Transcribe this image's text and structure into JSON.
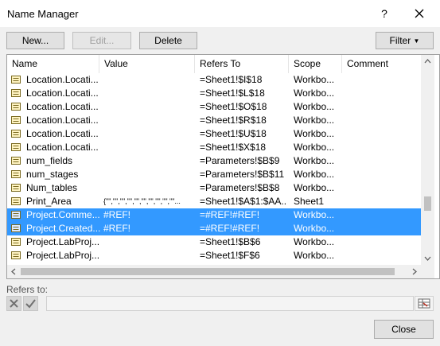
{
  "window": {
    "title": "Name Manager",
    "help_label": "?"
  },
  "toolbar": {
    "new_label": "New...",
    "edit_label": "Edit...",
    "delete_label": "Delete",
    "filter_label": "Filter"
  },
  "table": {
    "columns": [
      "Name",
      "Value",
      "Refers To",
      "Scope",
      "Comment"
    ],
    "rows": [
      {
        "name": "Location.Locati...",
        "value": "",
        "refers_to": "=Sheet1!$I$18",
        "scope": "Workbo...",
        "comment": "",
        "selected": false
      },
      {
        "name": "Location.Locati...",
        "value": "",
        "refers_to": "=Sheet1!$L$18",
        "scope": "Workbo...",
        "comment": "",
        "selected": false
      },
      {
        "name": "Location.Locati...",
        "value": "",
        "refers_to": "=Sheet1!$O$18",
        "scope": "Workbo...",
        "comment": "",
        "selected": false
      },
      {
        "name": "Location.Locati...",
        "value": "",
        "refers_to": "=Sheet1!$R$18",
        "scope": "Workbo...",
        "comment": "",
        "selected": false
      },
      {
        "name": "Location.Locati...",
        "value": "",
        "refers_to": "=Sheet1!$U$18",
        "scope": "Workbo...",
        "comment": "",
        "selected": false
      },
      {
        "name": "Location.Locati...",
        "value": "",
        "refers_to": "=Sheet1!$X$18",
        "scope": "Workbo...",
        "comment": "",
        "selected": false
      },
      {
        "name": "num_fields",
        "value": "",
        "refers_to": "=Parameters!$B$9",
        "scope": "Workbo...",
        "comment": "",
        "selected": false
      },
      {
        "name": "num_stages",
        "value": "",
        "refers_to": "=Parameters!$B$11",
        "scope": "Workbo...",
        "comment": "",
        "selected": false
      },
      {
        "name": "Num_tables",
        "value": "",
        "refers_to": "=Parameters!$B$8",
        "scope": "Workbo...",
        "comment": "",
        "selected": false
      },
      {
        "name": "Print_Area",
        "value": "{\"\",\"\",\"\",\"\",\"\",\"\",\"\",\"\",\"\",\"\"...",
        "refers_to": "=Sheet1!$A$1:$AA...",
        "scope": "Sheet1",
        "comment": "",
        "selected": false
      },
      {
        "name": "Project.Comme...",
        "value": "#REF!",
        "refers_to": "=#REF!#REF!",
        "scope": "Workbo...",
        "comment": "",
        "selected": true
      },
      {
        "name": "Project.Created...",
        "value": "#REF!",
        "refers_to": "=#REF!#REF!",
        "scope": "Workbo...",
        "comment": "",
        "selected": true
      },
      {
        "name": "Project.LabProj...",
        "value": "",
        "refers_to": "=Sheet1!$B$6",
        "scope": "Workbo...",
        "comment": "",
        "selected": false
      },
      {
        "name": "Project.LabProj...",
        "value": "",
        "refers_to": "=Sheet1!$F$6",
        "scope": "Workbo...",
        "comment": "",
        "selected": false
      }
    ]
  },
  "refers_to": {
    "label": "Refers to:",
    "value": ""
  },
  "footer": {
    "close_label": "Close"
  },
  "colors": {
    "selection": "#3399ff",
    "default_button_border": "#0078d7"
  }
}
